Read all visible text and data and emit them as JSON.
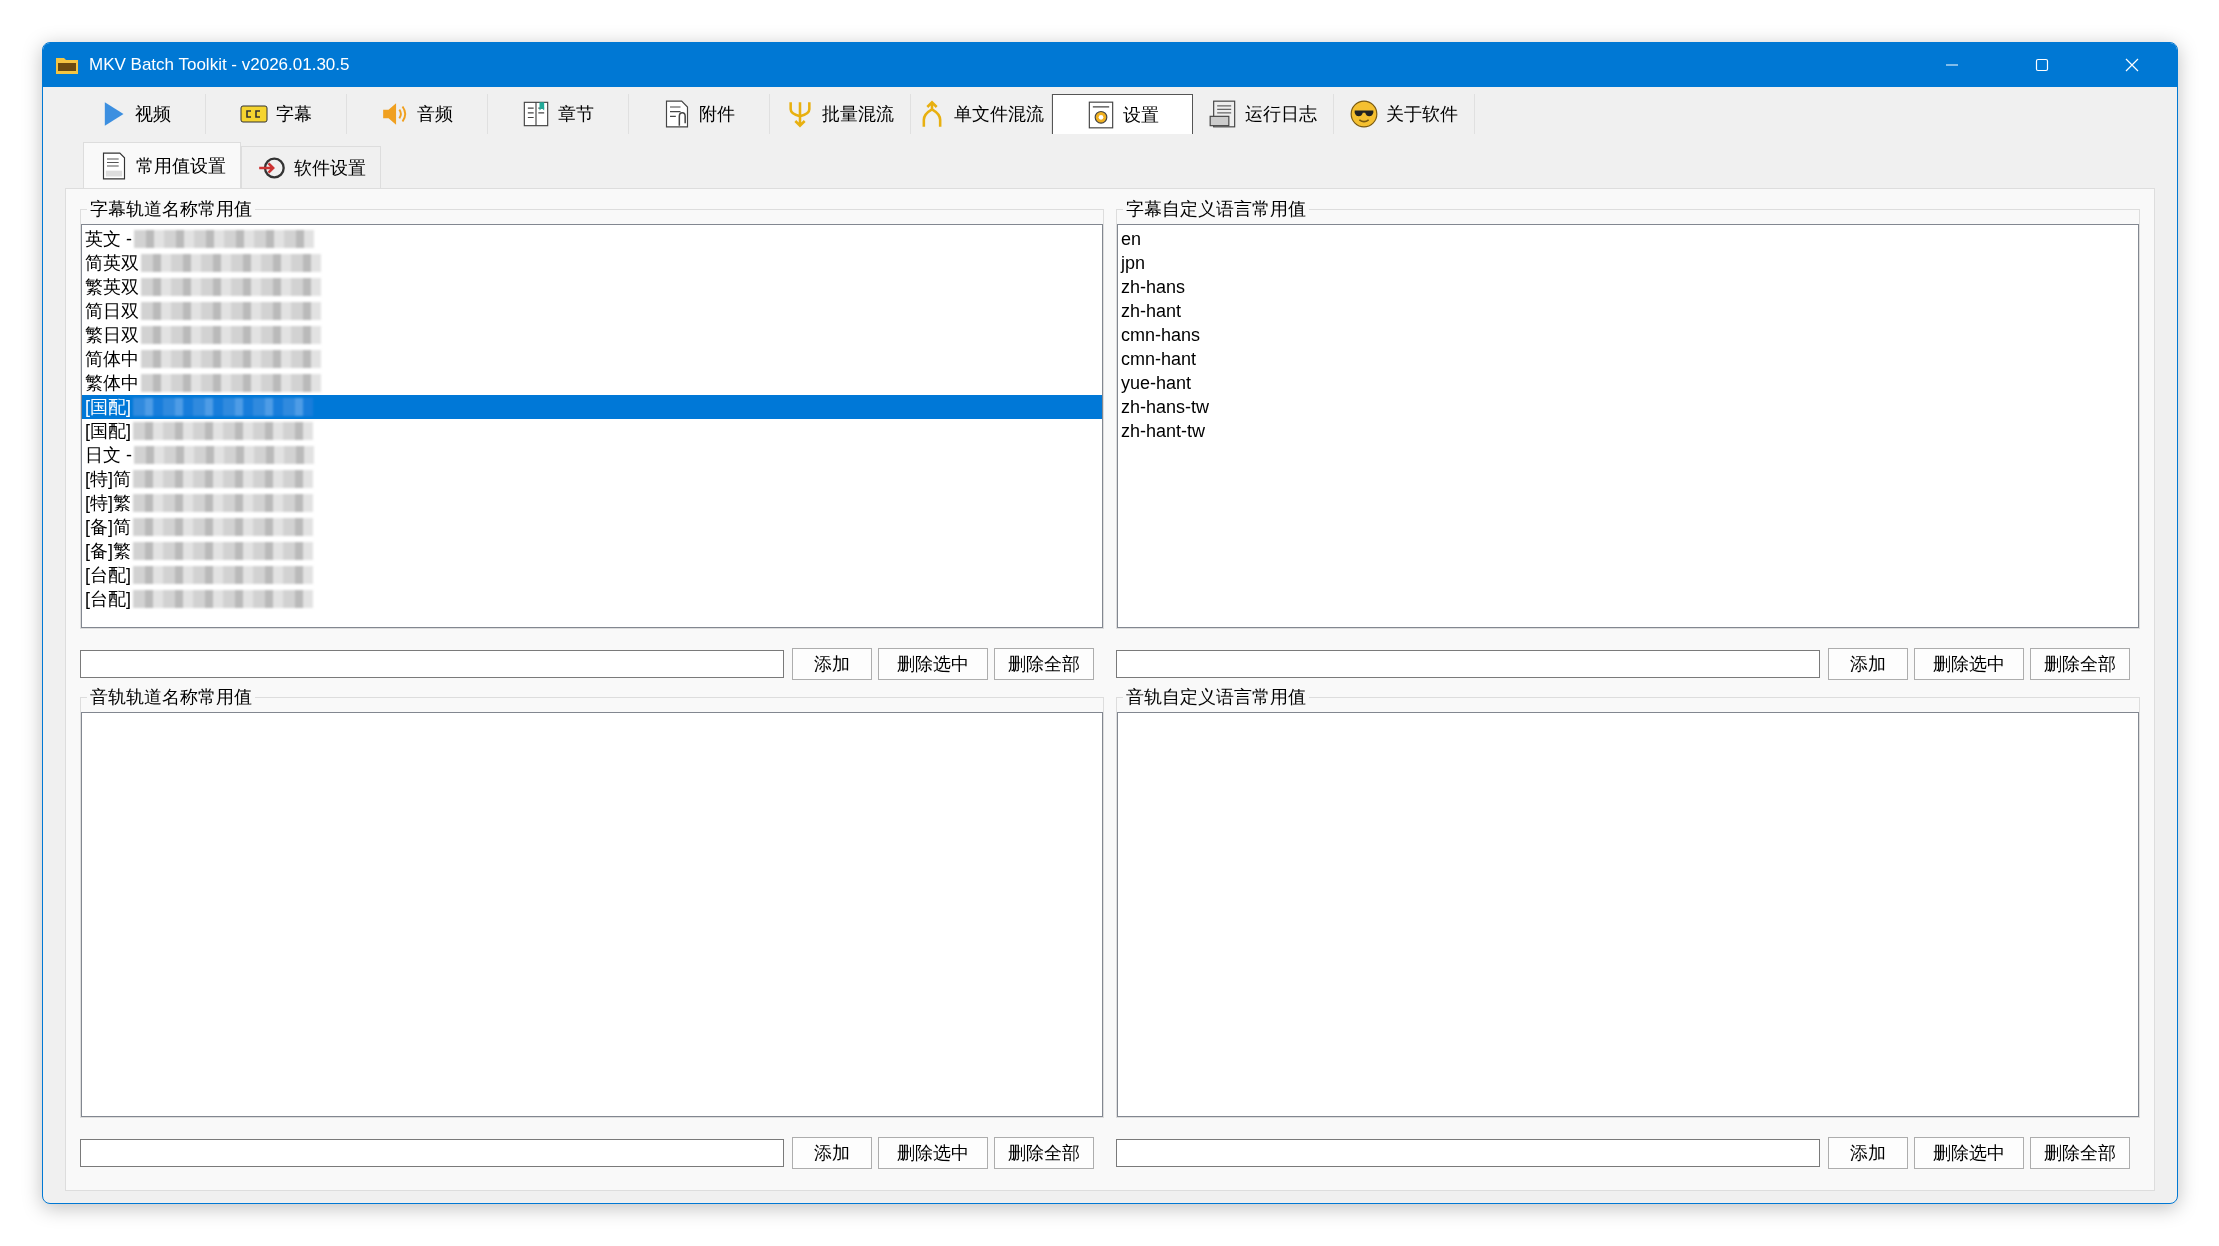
{
  "window": {
    "title": "MKV Batch Toolkit - v2026.01.30.5"
  },
  "toolbar_tabs": [
    {
      "label": "视频",
      "selected": false
    },
    {
      "label": "字幕",
      "selected": false
    },
    {
      "label": "音频",
      "selected": false
    },
    {
      "label": "章节",
      "selected": false
    },
    {
      "label": "附件",
      "selected": false
    },
    {
      "label": "批量混流",
      "selected": false
    },
    {
      "label": "单文件混流",
      "selected": false
    },
    {
      "label": "设置",
      "selected": true
    },
    {
      "label": "运行日志",
      "selected": false
    },
    {
      "label": "关于软件",
      "selected": false
    }
  ],
  "sub_tabs": [
    {
      "label": "常用值设置",
      "selected": true
    },
    {
      "label": "软件设置",
      "selected": false
    }
  ],
  "groups": [
    {
      "title": "字幕轨道名称常用值",
      "items": [
        {
          "text": "英文 -",
          "selected": false,
          "redacted": true
        },
        {
          "text": "简英双",
          "selected": false,
          "redacted": true
        },
        {
          "text": "繁英双",
          "selected": false,
          "redacted": true
        },
        {
          "text": "简日双",
          "selected": false,
          "redacted": true
        },
        {
          "text": "繁日双",
          "selected": false,
          "redacted": true
        },
        {
          "text": "简体中",
          "selected": false,
          "redacted": true
        },
        {
          "text": "繁体中",
          "selected": false,
          "redacted": true
        },
        {
          "text": "[国配]",
          "selected": true,
          "redacted": true
        },
        {
          "text": "[国配]",
          "selected": false,
          "redacted": true
        },
        {
          "text": "日文 -",
          "selected": false,
          "redacted": true
        },
        {
          "text": "[特]简",
          "selected": false,
          "redacted": true
        },
        {
          "text": "[特]繁",
          "selected": false,
          "redacted": true
        },
        {
          "text": "[备]简",
          "selected": false,
          "redacted": true
        },
        {
          "text": "[备]繁",
          "selected": false,
          "redacted": true
        },
        {
          "text": "[台配]",
          "selected": false,
          "redacted": true
        },
        {
          "text": "[台配]",
          "selected": false,
          "redacted": true
        }
      ],
      "buttons": [
        "添加",
        "删除选中",
        "删除全部"
      ]
    },
    {
      "title": "字幕自定义语言常用值",
      "items": [
        {
          "text": "en",
          "selected": false,
          "redacted": false
        },
        {
          "text": "jpn",
          "selected": false,
          "redacted": false
        },
        {
          "text": "zh-hans",
          "selected": false,
          "redacted": false
        },
        {
          "text": "zh-hant",
          "selected": false,
          "redacted": false
        },
        {
          "text": "cmn-hans",
          "selected": false,
          "redacted": false
        },
        {
          "text": "cmn-hant",
          "selected": false,
          "redacted": false
        },
        {
          "text": "yue-hant",
          "selected": false,
          "redacted": false
        },
        {
          "text": "zh-hans-tw",
          "selected": false,
          "redacted": false
        },
        {
          "text": "zh-hant-tw",
          "selected": false,
          "redacted": false
        }
      ],
      "buttons": [
        "添加",
        "删除选中",
        "删除全部"
      ]
    },
    {
      "title": "音轨轨道名称常用值",
      "buttons": [
        "添加",
        "删除选中",
        "删除全部"
      ]
    },
    {
      "title": "音轨自定义语言常用值",
      "buttons": [
        "添加",
        "删除选中",
        "删除全部"
      ]
    }
  ]
}
